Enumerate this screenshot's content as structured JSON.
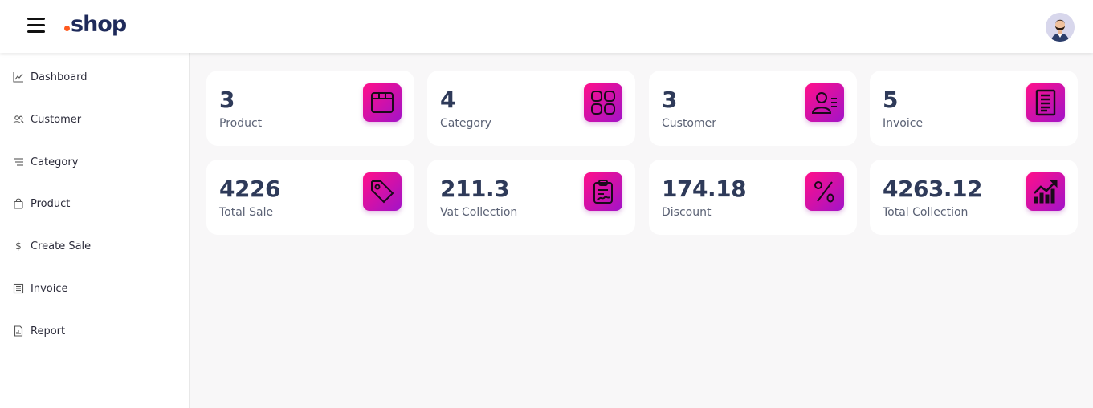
{
  "header": {
    "logo_text": "shop",
    "menu_icon": "hamburger-menu-icon",
    "avatar_icon": "user-avatar-icon",
    "logo_dot_color": "#ff5a1f"
  },
  "sidebar": {
    "items": [
      {
        "label": "Dashboard",
        "icon": "line-chart-icon"
      },
      {
        "label": "Customer",
        "icon": "users-icon"
      },
      {
        "label": "Category",
        "icon": "list-icon"
      },
      {
        "label": "Product",
        "icon": "shopping-bag-icon"
      },
      {
        "label": "Create Sale",
        "icon": "dollar-icon"
      },
      {
        "label": "Invoice",
        "icon": "receipt-icon"
      },
      {
        "label": "Report",
        "icon": "report-file-icon"
      }
    ]
  },
  "stats": [
    {
      "value": "3",
      "label": "Product",
      "icon": "box-icon"
    },
    {
      "value": "4",
      "label": "Category",
      "icon": "grid-icon"
    },
    {
      "value": "3",
      "label": "Customer",
      "icon": "customer-card-icon"
    },
    {
      "value": "5",
      "label": "Invoice",
      "icon": "invoice-document-icon"
    },
    {
      "value": "4226",
      "label": "Total Sale",
      "icon": "price-tag-icon"
    },
    {
      "value": "211.3",
      "label": "Vat Collection",
      "icon": "clipboard-signature-icon"
    },
    {
      "value": "174.18",
      "label": "Discount",
      "icon": "percent-icon"
    },
    {
      "value": "4263.12",
      "label": "Total Collection",
      "icon": "growth-chart-icon"
    }
  ],
  "colors": {
    "accent_gradient_start": "#ff0f8a",
    "accent_gradient_end": "#a213c8",
    "value_text": "#2e3a59"
  }
}
